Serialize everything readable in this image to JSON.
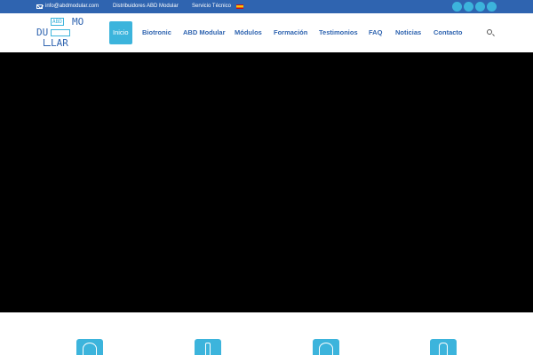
{
  "colors": {
    "brand_blue": "#2f64b0",
    "accent_cyan": "#3cb4dc",
    "hero_bg": "#000000"
  },
  "topbar": {
    "email": "info@abdmodular.com",
    "distributors": "Distribuidores ABD Modular",
    "service": "Servicio Técnico",
    "language_flag": "spain-flag-icon",
    "social_icons": [
      "social-icon-1",
      "social-icon-2",
      "social-icon-3",
      "social-icon-4"
    ]
  },
  "logo": {
    "abd": "ABD",
    "mo": "MO",
    "du": "DU",
    "lar": "LAR"
  },
  "nav": {
    "items": [
      {
        "label": "Inicio",
        "active": true
      },
      {
        "label": "Biotronic"
      },
      {
        "label": "ABD Modular"
      },
      {
        "label": "Módulos"
      },
      {
        "label": "Formación"
      },
      {
        "label": "Testimonios"
      },
      {
        "label": "FAQ"
      },
      {
        "label": "Noticias"
      },
      {
        "label": "Contacto"
      }
    ],
    "search_icon": "search-icon"
  },
  "features": {
    "icons": [
      "pen-tool-icon",
      "bottle-icon",
      "shield-icon",
      "hand-icon"
    ]
  }
}
